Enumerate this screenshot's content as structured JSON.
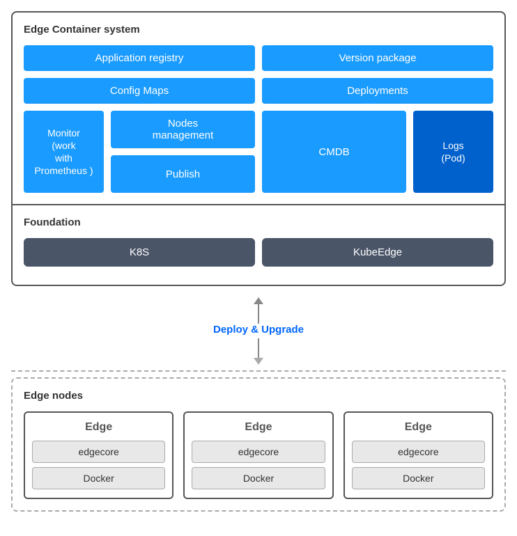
{
  "edgeContainerSystem": {
    "title": "Edge Container system",
    "row1": [
      {
        "label": "Application registry"
      },
      {
        "label": "Version package"
      }
    ],
    "row2": [
      {
        "label": "Config Maps"
      },
      {
        "label": "Deployments"
      }
    ],
    "bottomLeft": "Monitor\n(work\nwith\nPrometheus )",
    "bottomMiddleTop": "Nodes\nmanagement",
    "bottomMiddleBottom": "Publish",
    "bottomMiddleRight": "CMDB",
    "bottomRight": "Logs\n(Pod)"
  },
  "foundation": {
    "title": "Foundation",
    "items": [
      {
        "label": "K8S"
      },
      {
        "label": "KubeEdge"
      }
    ]
  },
  "arrow": {
    "label": "Deploy & Upgrade"
  },
  "edgeNodes": {
    "title": "Edge nodes",
    "nodes": [
      {
        "title": "Edge",
        "items": [
          "edgecore",
          "Docker"
        ]
      },
      {
        "title": "Edge",
        "items": [
          "edgecore",
          "Docker"
        ]
      },
      {
        "title": "Edge",
        "items": [
          "edgecore",
          "Docker"
        ]
      }
    ]
  }
}
